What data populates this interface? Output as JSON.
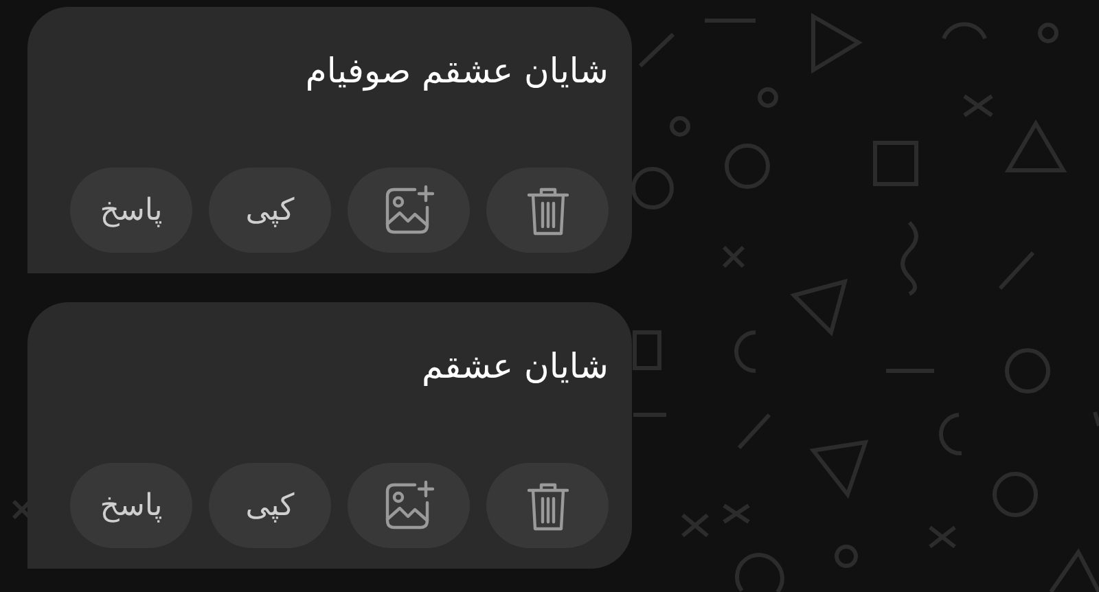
{
  "messages": [
    {
      "text": "شایان عشقم صوفیام",
      "actions": [
        {
          "kind": "delete"
        },
        {
          "kind": "add_image"
        },
        {
          "kind": "text",
          "label": "کپی"
        },
        {
          "kind": "text",
          "label": "پاسخ"
        }
      ]
    },
    {
      "text": "شایان عشقم",
      "actions": [
        {
          "kind": "delete"
        },
        {
          "kind": "add_image"
        },
        {
          "kind": "text",
          "label": "کپی"
        },
        {
          "kind": "text",
          "label": "پاسخ"
        }
      ]
    }
  ]
}
